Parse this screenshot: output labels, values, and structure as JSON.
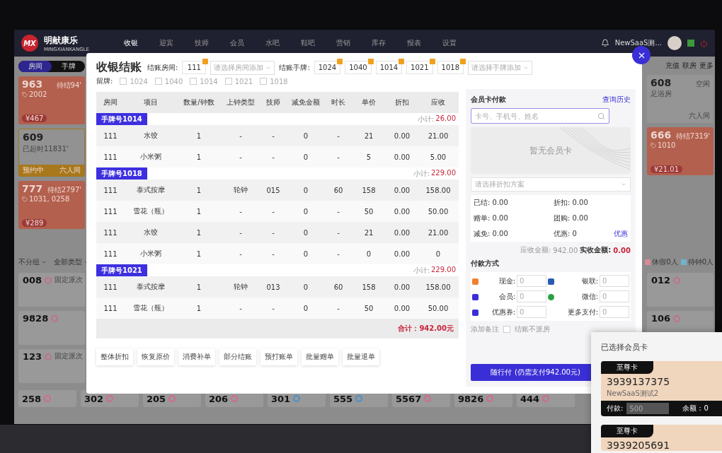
{
  "app": {
    "logo_mark": "MX",
    "brand": "明献康乐",
    "brand_sub": "MINGXIANKANGLE",
    "user": "NewSaaS测...",
    "nav": [
      {
        "label": "收银",
        "selected": true
      },
      {
        "label": "迎宾",
        "selected": false
      },
      {
        "label": "技师",
        "selected": false
      },
      {
        "label": "会员",
        "selected": false
      },
      {
        "label": "水吧",
        "selected": false
      },
      {
        "label": "鞋吧",
        "selected": false
      },
      {
        "label": "营销",
        "selected": false
      },
      {
        "label": "库存",
        "selected": false
      },
      {
        "label": "报表",
        "selected": false
      },
      {
        "label": "设置",
        "selected": false
      }
    ]
  },
  "room_toggle": [
    {
      "label": "房间",
      "selected": true
    },
    {
      "label": "手牌",
      "selected": false
    }
  ],
  "left_rooms": [
    {
      "kind": "pending",
      "number": "963",
      "status": "待结94'",
      "tags": "2002",
      "price": "¥467"
    },
    {
      "kind": "reserved",
      "number": "609",
      "status": "已起时11831'",
      "badge": "预约中",
      "room_type": "六人间"
    },
    {
      "kind": "pending",
      "number": "777",
      "status": "待结2797'",
      "tags": "1031, 0258",
      "price": "¥289"
    }
  ],
  "right_actions": [
    "充值",
    "联房",
    "更多"
  ],
  "right_rooms": [
    {
      "kind": "free",
      "number": "608",
      "status": "空闲",
      "tags": "足浴房",
      "room_type": "六人间"
    },
    {
      "kind": "pending",
      "number": "666",
      "status": "待结7319'",
      "tags": "1010",
      "price": "¥21.01"
    }
  ],
  "filters": [
    "不分组",
    "全部类型"
  ],
  "legend": [
    {
      "label": "休假0人",
      "color": "#d98a96"
    },
    {
      "label": "待钟0人",
      "color": "#6fb3cf"
    }
  ],
  "techs_left": [
    {
      "number": "008",
      "status": "固定派次"
    },
    {
      "number": "9828"
    },
    {
      "number": "123",
      "status": "固定派次"
    }
  ],
  "techs_right": [
    {
      "number": "012"
    },
    {
      "number": "106"
    }
  ],
  "bottom_techs": [
    {
      "number": "258",
      "color": "#d46a8a"
    },
    {
      "number": "302",
      "color": "#d46a8a"
    },
    {
      "number": "205",
      "color": "#d46a8a"
    },
    {
      "number": "206",
      "color": "#d46a8a"
    },
    {
      "number": "301",
      "color": "#4a90c8"
    },
    {
      "number": "555",
      "color": "#4a90c8"
    },
    {
      "number": "5567",
      "color": "#d46a8a"
    },
    {
      "number": "9826",
      "color": "#d46a8a"
    },
    {
      "number": "444",
      "color": "#d46a8a"
    }
  ],
  "modal": {
    "title": "收银结账",
    "room_label": "结账房间:",
    "rooms": [
      "111"
    ],
    "room_select": {
      "placeholder": "请选择房间添加"
    },
    "tag_label": "结账手牌:",
    "tags": [
      "1024",
      "1040",
      "1014",
      "1021",
      "1018"
    ],
    "tag_select": {
      "placeholder": "请选择手牌添加"
    },
    "keep_label": "留牌:",
    "keep": [
      {
        "label": "1024",
        "checked": false
      },
      {
        "label": "1040",
        "checked": false
      },
      {
        "label": "1014",
        "checked": false
      },
      {
        "label": "1021",
        "checked": false
      },
      {
        "label": "1018",
        "checked": false
      }
    ],
    "columns": [
      "房间",
      "项目",
      "数量/钟数",
      "上钟类型",
      "技师",
      "减免金额",
      "时长",
      "单价",
      "折扣",
      "应收"
    ],
    "groups": [
      {
        "label": "手牌号1014",
        "subtotal_label": "小计:",
        "subtotal": "26.00",
        "rows": [
          [
            "111",
            "水饺",
            "1",
            "-",
            "-",
            "0",
            "-",
            "21",
            "0.00",
            "21.00"
          ],
          [
            "111",
            "小米粥",
            "1",
            "-",
            "-",
            "0",
            "-",
            "5",
            "0.00",
            "5.00"
          ]
        ]
      },
      {
        "label": "手牌号1018",
        "subtotal_label": "小计:",
        "subtotal": "229.00",
        "rows": [
          [
            "111",
            "泰式按摩",
            "1",
            "轮钟",
            "015",
            "0",
            "60",
            "158",
            "0.00",
            "158.00"
          ],
          [
            "111",
            "雪花（瓶）",
            "1",
            "-",
            "-",
            "0",
            "-",
            "50",
            "0.00",
            "50.00"
          ],
          [
            "111",
            "水饺",
            "1",
            "-",
            "-",
            "0",
            "-",
            "21",
            "0.00",
            "21.00"
          ],
          [
            "111",
            "小米粥",
            "1",
            "-",
            "-",
            "0",
            "-",
            "0",
            "0.00",
            "0"
          ]
        ]
      },
      {
        "label": "手牌号1021",
        "subtotal_label": "小计:",
        "subtotal": "229.00",
        "rows": [
          [
            "111",
            "泰式按摩",
            "1",
            "轮钟",
            "013",
            "0",
            "60",
            "158",
            "0.00",
            "158.00"
          ],
          [
            "111",
            "雪花（瓶）",
            "1",
            "-",
            "-",
            "0",
            "-",
            "50",
            "0.00",
            "50.00"
          ]
        ]
      }
    ],
    "total": "合计：942.00元",
    "actions": [
      "整体折扣",
      "恢复原价",
      "消费补单",
      "部分结账",
      "预打账单",
      "批量赠单",
      "批量退单"
    ],
    "member": {
      "title": "会员卡付款",
      "history": "查询历史",
      "search": {
        "placeholder": "卡号、手机号、姓名"
      },
      "empty": "暂无会员卡",
      "discount": {
        "placeholder": "请选择折扣方案"
      },
      "summary": [
        {
          "label": "已结:",
          "value": "0.00"
        },
        {
          "label": "折扣:",
          "value": "0.00"
        },
        {
          "label": "赠单:",
          "value": "0.00"
        },
        {
          "label": "团购:",
          "value": "0.00"
        },
        {
          "label": "减免:",
          "value": "0.00"
        },
        {
          "label": "优惠:",
          "value": "0"
        }
      ],
      "offer_link": "优惠",
      "due_label": "应收金额:",
      "due": "942.00",
      "paid_label": "实收金额:",
      "paid": "0.00"
    },
    "pay_title": "付款方式",
    "methods": [
      {
        "kind": "cash",
        "label": "现金:",
        "placeholder": "0"
      },
      {
        "kind": "unionpay",
        "label": "银联:",
        "placeholder": "0"
      },
      {
        "kind": "member",
        "label": "会员:",
        "placeholder": "0"
      },
      {
        "kind": "wechat",
        "label": "微信:",
        "placeholder": "0"
      },
      {
        "kind": "coupon",
        "label": "优惠券:",
        "placeholder": "0"
      },
      {
        "kind": "more",
        "label": "更多支付:",
        "placeholder": "0"
      }
    ],
    "note": "添加备注",
    "no_room": {
      "label": "结账不派房",
      "checked": false
    },
    "pay_button": "随行付",
    "pay_hint": "(仍需支付942.00元)"
  },
  "selected_cards": {
    "title": "已选择会员卡",
    "cards": [
      {
        "type": "至尊卡",
        "number": "3939137375",
        "name": "NewSaaS测试2",
        "pay_label": "付款:",
        "pay_field": {
          "placeholder": "500"
        },
        "balance": "余额：0"
      },
      {
        "type": "至尊卡",
        "number": "3939205691"
      }
    ]
  }
}
